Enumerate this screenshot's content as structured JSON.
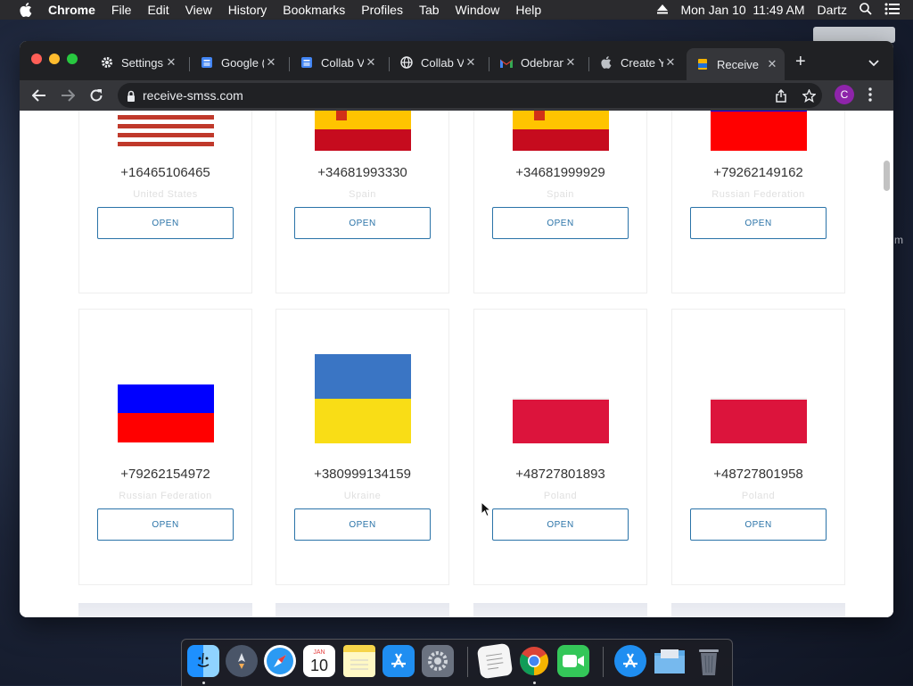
{
  "menubar": {
    "app": "Chrome",
    "items": [
      "File",
      "Edit",
      "View",
      "History",
      "Bookmarks",
      "Profiles",
      "Tab",
      "Window",
      "Help"
    ],
    "datetime": "Mon Jan 10  11:49 AM",
    "user": "Dartz"
  },
  "browser": {
    "tabs": [
      {
        "label": "Settings",
        "icon": "gear-icon"
      },
      {
        "label": "Google (",
        "icon": "google-sites-icon"
      },
      {
        "label": "Collab V",
        "icon": "google-sites-icon"
      },
      {
        "label": "Collab V",
        "icon": "globe-icon"
      },
      {
        "label": "Odebran",
        "icon": "gmail-icon"
      },
      {
        "label": "Create Y",
        "icon": "apple-icon"
      },
      {
        "label": "Receive",
        "icon": "site-favicon-icon"
      }
    ],
    "active_tab_index": 6,
    "url": "receive-smss.com",
    "profile_initial": "C"
  },
  "cards": [
    {
      "number": "+16465106465",
      "country": "United States",
      "flag": "us",
      "button": "OPEN"
    },
    {
      "number": "+34681993330",
      "country": "Spain",
      "flag": "es",
      "button": "OPEN"
    },
    {
      "number": "+34681999929",
      "country": "Spain",
      "flag": "es",
      "button": "OPEN"
    },
    {
      "number": "+79262149162",
      "country": "Russian Federation",
      "flag": "ru",
      "button": "OPEN"
    },
    {
      "number": "+79262154972",
      "country": "Russian Federation",
      "flag": "ru",
      "button": "OPEN"
    },
    {
      "number": "+380999134159",
      "country": "Ukraine",
      "flag": "ua",
      "button": "OPEN"
    },
    {
      "number": "+48727801893",
      "country": "Poland",
      "flag": "pl",
      "button": "OPEN"
    },
    {
      "number": "+48727801958",
      "country": "Poland",
      "flag": "pl",
      "button": "OPEN"
    }
  ],
  "colors": {
    "button_border": "#2a73a8",
    "russia_blue": "#0000ff",
    "russia_red": "#ff0000",
    "ukraine_blue": "#3a75c4",
    "ukraine_yellow": "#f9dd16",
    "poland_red": "#dc143c",
    "spain_red": "#c60b1e",
    "spain_yellow": "#ffc400"
  },
  "dock": [
    "finder-icon",
    "launchpad-icon",
    "safari-icon",
    "calendar-icon",
    "notes-icon",
    "app-store-icon",
    "system-preferences-icon",
    "textedit-icon",
    "chrome-icon",
    "facetime-icon",
    "app-store-icon",
    "downloads-folder-icon",
    "trash-icon"
  ],
  "dock_calendar": {
    "month": "JAN",
    "day": "10"
  }
}
